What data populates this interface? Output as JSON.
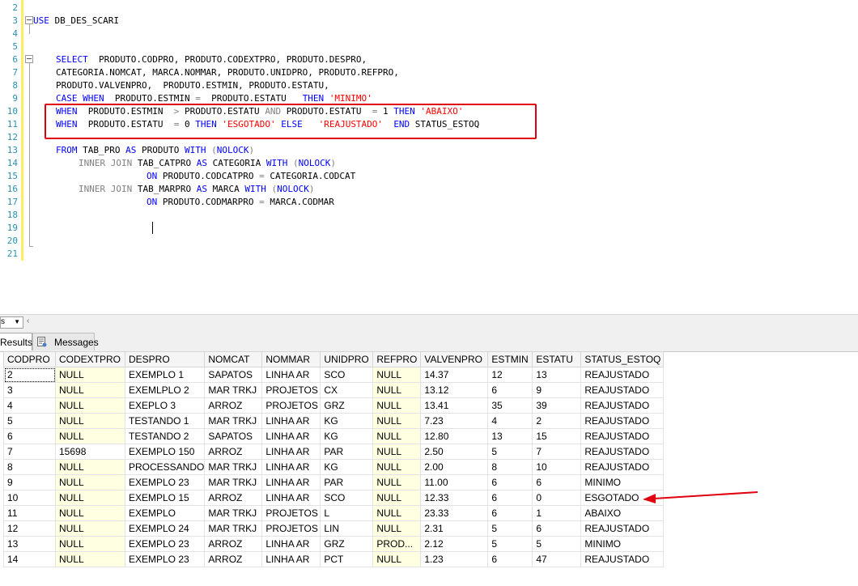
{
  "editor": {
    "line_numbers": [
      "2",
      "3",
      "4",
      "5",
      "6",
      "7",
      "8",
      "9",
      "10",
      "11",
      "12",
      "13",
      "14",
      "15",
      "16",
      "17",
      "18",
      "19",
      "20",
      "21"
    ],
    "lines": {
      "l3": [
        {
          "t": "USE",
          "c": "kw"
        },
        {
          "t": " DB_DES_SCARI",
          "c": ""
        }
      ],
      "l6": [
        {
          "t": "SELECT",
          "c": "kw"
        },
        {
          "t": "  PRODUTO.CODPRO, PRODUTO.CODEXTPRO, PRODUTO.DESPRO,",
          "c": ""
        }
      ],
      "l7": [
        {
          "t": "CATEGORIA.NOMCAT, MARCA.NOMMAR, PRODUTO.UNIDPRO, PRODUTO.REFPRO,",
          "c": ""
        }
      ],
      "l8": [
        {
          "t": "PRODUTO.VALVENPRO,  PRODUTO.ESTMIN, PRODUTO.ESTATU,",
          "c": ""
        }
      ],
      "l9": [
        {
          "t": "CASE",
          "c": "kw"
        },
        {
          "t": " ",
          "c": ""
        },
        {
          "t": "WHEN",
          "c": "kw"
        },
        {
          "t": "  PRODUTO.ESTMIN ",
          "c": ""
        },
        {
          "t": "=",
          "c": "gr"
        },
        {
          "t": "  PRODUTO.ESTATU   ",
          "c": ""
        },
        {
          "t": "THEN",
          "c": "kw"
        },
        {
          "t": " ",
          "c": ""
        },
        {
          "t": "'MINIMO'",
          "c": "str"
        }
      ],
      "l10": [
        {
          "t": "WHEN",
          "c": "kw"
        },
        {
          "t": "  PRODUTO.ESTMIN  ",
          "c": ""
        },
        {
          "t": ">",
          "c": "gr"
        },
        {
          "t": " PRODUTO.ESTATU ",
          "c": ""
        },
        {
          "t": "AND",
          "c": "gr"
        },
        {
          "t": " PRODUTO.ESTATU  ",
          "c": ""
        },
        {
          "t": "=",
          "c": "gr"
        },
        {
          "t": " 1 ",
          "c": ""
        },
        {
          "t": "THEN",
          "c": "kw"
        },
        {
          "t": " ",
          "c": ""
        },
        {
          "t": "'ABAIXO'",
          "c": "str"
        }
      ],
      "l11": [
        {
          "t": "WHEN",
          "c": "kw"
        },
        {
          "t": "  PRODUTO.ESTATU  ",
          "c": ""
        },
        {
          "t": "=",
          "c": "gr"
        },
        {
          "t": " 0 ",
          "c": ""
        },
        {
          "t": "THEN",
          "c": "kw"
        },
        {
          "t": " ",
          "c": ""
        },
        {
          "t": "'ESGOTADO'",
          "c": "str"
        },
        {
          "t": " ",
          "c": ""
        },
        {
          "t": "ELSE",
          "c": "kw"
        },
        {
          "t": "   ",
          "c": ""
        },
        {
          "t": "'REAJUSTADO'",
          "c": "str"
        },
        {
          "t": "  ",
          "c": ""
        },
        {
          "t": "END",
          "c": "kw"
        },
        {
          "t": " STATUS_ESTOQ",
          "c": ""
        }
      ],
      "l13": [
        {
          "t": "FROM",
          "c": "kw"
        },
        {
          "t": " TAB_PRO ",
          "c": ""
        },
        {
          "t": "AS",
          "c": "kw"
        },
        {
          "t": " PRODUTO ",
          "c": ""
        },
        {
          "t": "WITH",
          "c": "kw"
        },
        {
          "t": " ",
          "c": ""
        },
        {
          "t": "(",
          "c": "gr"
        },
        {
          "t": "NOLOCK",
          "c": "kw"
        },
        {
          "t": ")",
          "c": "gr"
        }
      ],
      "l14": [
        {
          "t": "INNER JOIN",
          "c": "gr"
        },
        {
          "t": " TAB_CATPRO ",
          "c": ""
        },
        {
          "t": "AS",
          "c": "kw"
        },
        {
          "t": " CATEGORIA ",
          "c": ""
        },
        {
          "t": "WITH",
          "c": "kw"
        },
        {
          "t": " ",
          "c": ""
        },
        {
          "t": "(",
          "c": "gr"
        },
        {
          "t": "NOLOCK",
          "c": "kw"
        },
        {
          "t": ")",
          "c": "gr"
        }
      ],
      "l15": [
        {
          "t": "ON",
          "c": "kw"
        },
        {
          "t": " PRODUTO.CODCATPRO ",
          "c": ""
        },
        {
          "t": "=",
          "c": "gr"
        },
        {
          "t": " CATEGORIA.CODCAT",
          "c": ""
        }
      ],
      "l16": [
        {
          "t": "INNER JOIN",
          "c": "gr"
        },
        {
          "t": " TAB_MARPRO ",
          "c": ""
        },
        {
          "t": "AS",
          "c": "kw"
        },
        {
          "t": " MARCA ",
          "c": ""
        },
        {
          "t": "WITH",
          "c": "kw"
        },
        {
          "t": " ",
          "c": ""
        },
        {
          "t": "(",
          "c": "gr"
        },
        {
          "t": "NOLOCK",
          "c": "kw"
        },
        {
          "t": ")",
          "c": "gr"
        }
      ],
      "l17": [
        {
          "t": "ON",
          "c": "kw"
        },
        {
          "t": " PRODUTO.CODMARPRO ",
          "c": ""
        },
        {
          "t": "=",
          "c": "gr"
        },
        {
          "t": " MARCA.CODMAR",
          "c": ""
        }
      ]
    }
  },
  "results_pane": {
    "zoom_value": "s",
    "tabs": {
      "results": "Results",
      "messages": "Messages"
    },
    "columns": [
      "CODPRO",
      "CODEXTPRO",
      "DESPRO",
      "NOMCAT",
      "NOMMAR",
      "UNIDPRO",
      "REFPRO",
      "VALVENPRO",
      "ESTMIN",
      "ESTATU",
      "STATUS_ESTOQ"
    ],
    "rows": [
      [
        "2",
        "NULL",
        "EXEMPLO 1",
        "SAPATOS",
        "LINHA AR",
        "SCO",
        "NULL",
        "14.37",
        "12",
        "13",
        "REAJUSTADO"
      ],
      [
        "3",
        "NULL",
        "EXEMLPLO 2",
        "MAR TRKJ",
        "PROJETOS",
        "CX",
        "NULL",
        "13.12",
        "6",
        "9",
        "REAJUSTADO"
      ],
      [
        "4",
        "NULL",
        "EXEPLO 3",
        "ARROZ",
        "PROJETOS",
        "GRZ",
        "NULL",
        "13.41",
        "35",
        "39",
        "REAJUSTADO"
      ],
      [
        "5",
        "NULL",
        "TESTANDO 1",
        "MAR TRKJ",
        "LINHA AR",
        "KG",
        "NULL",
        "7.23",
        "4",
        "2",
        "REAJUSTADO"
      ],
      [
        "6",
        "NULL",
        "TESTANDO 2",
        "SAPATOS",
        "LINHA AR",
        "KG",
        "NULL",
        "12.80",
        "13",
        "15",
        "REAJUSTADO"
      ],
      [
        "7",
        "15698",
        "EXEMPLO 150",
        "ARROZ",
        "LINHA AR",
        "PAR",
        "NULL",
        "2.50",
        "5",
        "7",
        "REAJUSTADO"
      ],
      [
        "8",
        "NULL",
        "PROCESSANDO",
        "MAR TRKJ",
        "LINHA AR",
        "KG",
        "NULL",
        "2.00",
        "8",
        "10",
        "REAJUSTADO"
      ],
      [
        "9",
        "NULL",
        "EXEMPLO 23",
        "MAR TRKJ",
        "LINHA AR",
        "PAR",
        "NULL",
        "11.00",
        "6",
        "6",
        "MINIMO"
      ],
      [
        "10",
        "NULL",
        "EXEMPLO 15",
        "ARROZ",
        "LINHA AR",
        "SCO",
        "NULL",
        "12.33",
        "6",
        "0",
        "ESGOTADO"
      ],
      [
        "11",
        "NULL",
        "EXEMPLO",
        "MAR TRKJ",
        "PROJETOS",
        "L",
        "NULL",
        "23.33",
        "6",
        "1",
        "ABAIXO"
      ],
      [
        "12",
        "NULL",
        "EXEMPLO 24",
        "MAR TRKJ",
        "PROJETOS",
        "LIN",
        "NULL",
        "2.31",
        "5",
        "6",
        "REAJUSTADO"
      ],
      [
        "13",
        "NULL",
        "EXEMPLO 23",
        "ARROZ",
        "LINHA AR",
        "GRZ",
        "PROD...",
        "2.12",
        "5",
        "5",
        "MINIMO"
      ],
      [
        "14",
        "NULL",
        "EXEMPLO 23",
        "ARROZ",
        "LINHA AR",
        "PCT",
        "NULL",
        "1.23",
        "6",
        "47",
        "REAJUSTADO"
      ]
    ]
  },
  "colors": {
    "annotation_red": "#e0000f",
    "keyword_blue": "#0000ff",
    "string_red": "#ff0000",
    "null_cell_bg": "#ffffe1"
  }
}
